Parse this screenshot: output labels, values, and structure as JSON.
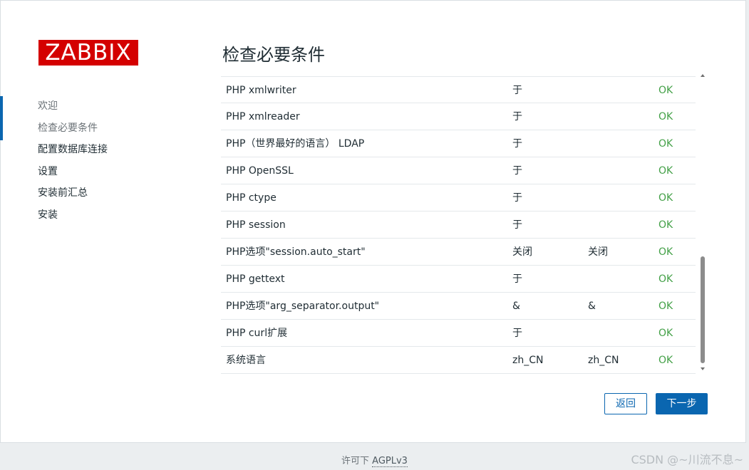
{
  "logo": {
    "text": "ZABBIX",
    "color": "#d40000"
  },
  "sidebar": {
    "items": [
      {
        "label": "欢迎",
        "state": "done"
      },
      {
        "label": "检查必要条件",
        "state": "current"
      },
      {
        "label": "配置数据库连接",
        "state": "todo"
      },
      {
        "label": "设置",
        "state": "todo"
      },
      {
        "label": "安装前汇总",
        "state": "todo"
      },
      {
        "label": "安装",
        "state": "todo"
      }
    ]
  },
  "main": {
    "title": "检查必要条件",
    "rows": [
      {
        "name": "PHP xmlwriter",
        "current": "于",
        "required": "",
        "status": "OK"
      },
      {
        "name": "PHP xmlreader",
        "current": "于",
        "required": "",
        "status": "OK"
      },
      {
        "name": "PHP（世界最好的语言） LDAP",
        "current": "于",
        "required": "",
        "status": "OK"
      },
      {
        "name": "PHP OpenSSL",
        "current": "于",
        "required": "",
        "status": "OK"
      },
      {
        "name": "PHP ctype",
        "current": "于",
        "required": "",
        "status": "OK"
      },
      {
        "name": "PHP session",
        "current": "于",
        "required": "",
        "status": "OK"
      },
      {
        "name": "PHP选项\"session.auto_start\"",
        "current": "关闭",
        "required": "关闭",
        "status": "OK"
      },
      {
        "name": "PHP gettext",
        "current": "于",
        "required": "",
        "status": "OK"
      },
      {
        "name": "PHP选项\"arg_separator.output\"",
        "current": "&",
        "required": "&",
        "status": "OK"
      },
      {
        "name": "PHP curl扩展",
        "current": "于",
        "required": "",
        "status": "OK"
      },
      {
        "name": "系统语言",
        "current": "zh_CN",
        "required": "zh_CN",
        "status": "OK"
      }
    ]
  },
  "buttons": {
    "back": "返回",
    "next": "下一步"
  },
  "footer": {
    "prefix": "许可下 ",
    "license": "AGPLv3"
  },
  "watermark": "CSDN @~川流不息~",
  "colors": {
    "accent": "#0a66b0",
    "ok": "#43a047"
  }
}
